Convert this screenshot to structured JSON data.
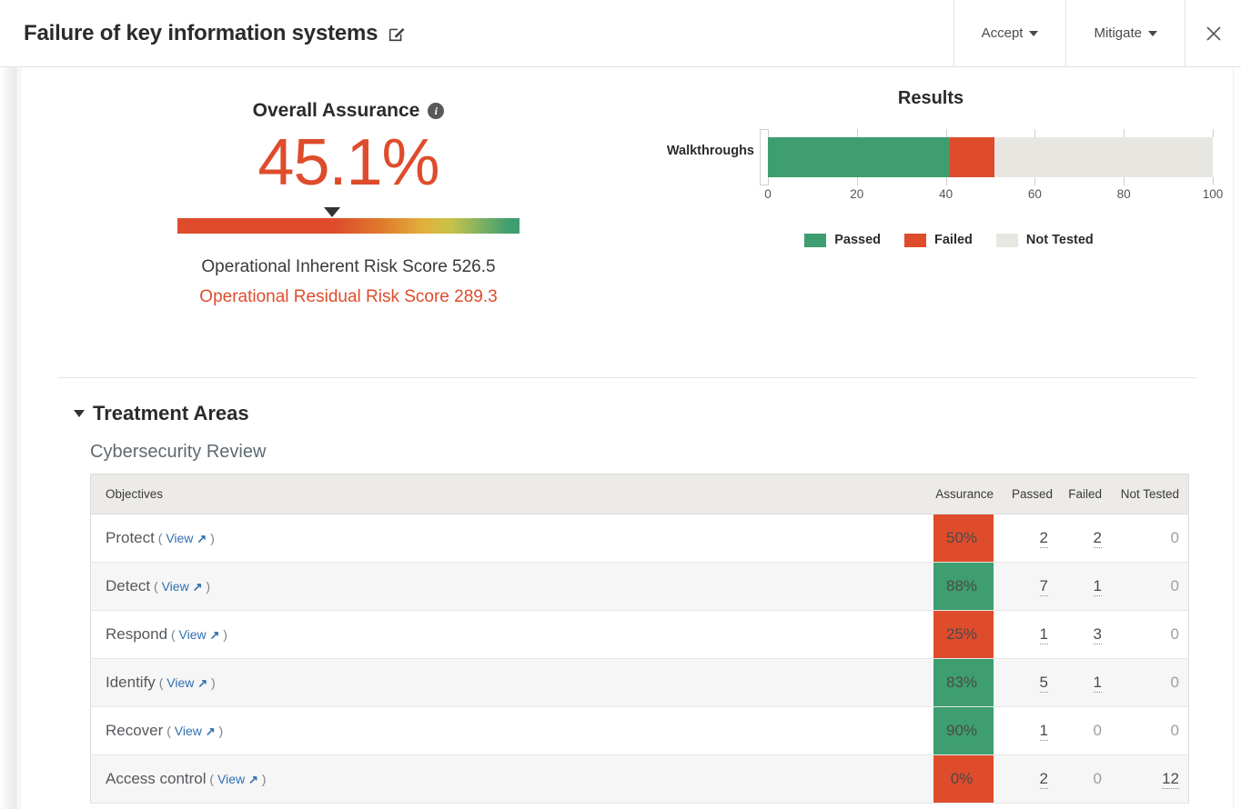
{
  "header": {
    "title": "Failure of key information systems",
    "edit_icon": "edit-pencil-icon",
    "accept_label": "Accept",
    "mitigate_label": "Mitigate",
    "close_icon": "close-icon"
  },
  "assurance": {
    "title": "Overall Assurance",
    "info_icon": "info-icon",
    "value": "45.1%",
    "gauge_marker_percent": 45.1,
    "inherent_label": "Operational Inherent Risk Score 526.5",
    "residual_label": "Operational Residual Risk Score 289.3",
    "value_color": "#DE4C2C",
    "residual_color": "#DE4C2C"
  },
  "results": {
    "title": "Results",
    "legend": [
      {
        "label": "Passed",
        "color": "#3E9E6F"
      },
      {
        "label": "Failed",
        "color": "#DE4C2C"
      },
      {
        "label": "Not Tested",
        "color": "#E8E6E1"
      }
    ]
  },
  "chart_data": {
    "type": "bar",
    "orientation": "horizontal",
    "stacked": true,
    "title": "Results",
    "categories": [
      "Walkthroughs"
    ],
    "series": [
      {
        "name": "Passed",
        "values": [
          41
        ],
        "color": "#3E9E6F"
      },
      {
        "name": "Failed",
        "values": [
          10
        ],
        "color": "#DE4C2C"
      },
      {
        "name": "Not Tested",
        "values": [
          49
        ],
        "color": "#E8E6E1"
      }
    ],
    "xlabel": "",
    "ylabel": "",
    "xlim": [
      0,
      100
    ],
    "xticks": [
      0,
      20,
      40,
      60,
      80,
      100
    ],
    "grid": true,
    "legend_position": "bottom"
  },
  "treatment": {
    "section_title": "Treatment Areas",
    "collapse_icon": "triangle-down-icon",
    "subsection_title": "Cybersecurity Review",
    "columns": [
      "Objectives",
      "Assurance",
      "Passed",
      "Failed",
      "Not Tested"
    ],
    "view_open": "(",
    "view_label": "View",
    "view_icon": "external-link-icon",
    "view_close": ")",
    "rows": [
      {
        "objective": "Protect",
        "assurance": "50%",
        "assurance_state": "red",
        "passed": "2",
        "failed": "2",
        "not_tested": "0"
      },
      {
        "objective": "Detect",
        "assurance": "88%",
        "assurance_state": "green",
        "passed": "7",
        "failed": "1",
        "not_tested": "0"
      },
      {
        "objective": "Respond",
        "assurance": "25%",
        "assurance_state": "red",
        "passed": "1",
        "failed": "3",
        "not_tested": "0"
      },
      {
        "objective": "Identify",
        "assurance": "83%",
        "assurance_state": "green",
        "passed": "5",
        "failed": "1",
        "not_tested": "0"
      },
      {
        "objective": "Recover",
        "assurance": "90%",
        "assurance_state": "green",
        "passed": "1",
        "failed": "0",
        "not_tested": "0"
      },
      {
        "objective": "Access control",
        "assurance": "0%",
        "assurance_state": "red",
        "passed": "2",
        "failed": "0",
        "not_tested": "12"
      }
    ]
  }
}
